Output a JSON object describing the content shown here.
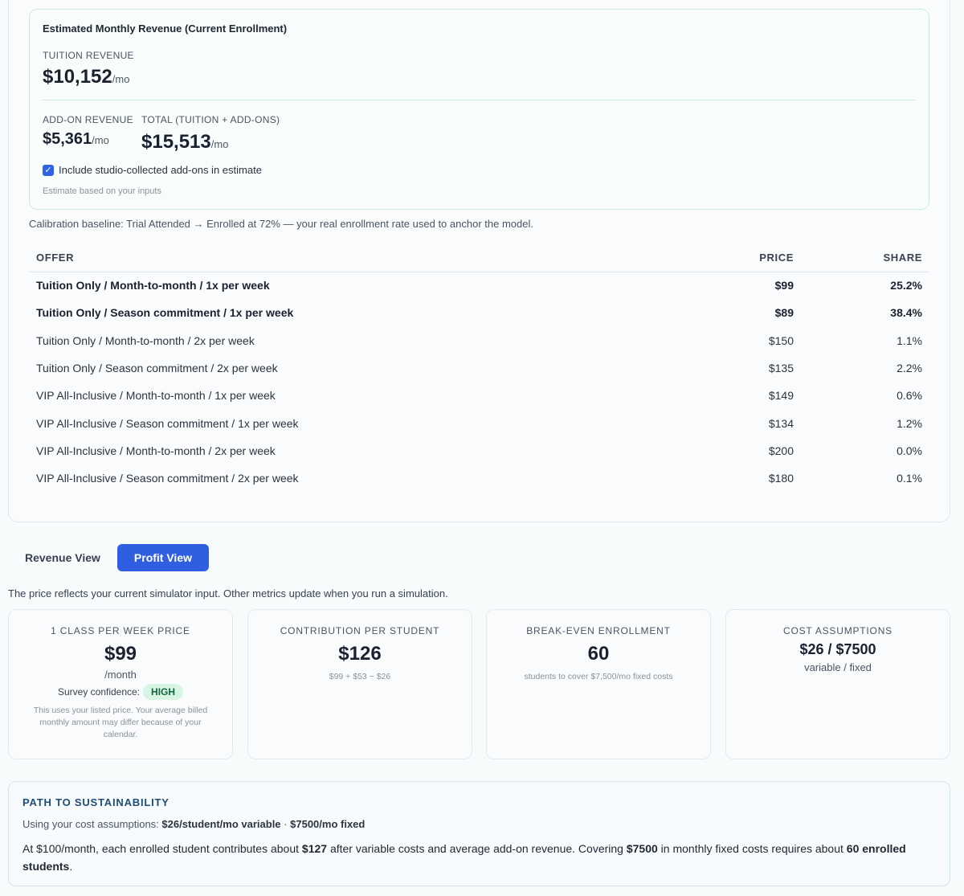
{
  "revenue": {
    "title": "Estimated Monthly Revenue (Current Enrollment)",
    "tuition_label": "TUITION REVENUE",
    "tuition_value": "$10,152",
    "per_month": "/mo",
    "addon_label": "ADD-ON REVENUE",
    "addon_value": "$5,361",
    "total_label": "TOTAL (TUITION + ADD-ONS)",
    "total_value": "$15,513",
    "checkbox_label": "Include studio-collected add-ons in estimate",
    "checkbox_checked": true,
    "estimate_note": "Estimate based on your inputs"
  },
  "calibration_text": "Calibration baseline: Trial Attended → Enrolled at 72% — your real enrollment rate used to anchor the model.",
  "offers": {
    "headers": [
      "OFFER",
      "PRICE",
      "SHARE"
    ],
    "rows": [
      {
        "offer": "Tuition Only / Month-to-month / 1x per week",
        "price": "$99",
        "share": "25.2%",
        "bold": true
      },
      {
        "offer": "Tuition Only / Season commitment / 1x per week",
        "price": "$89",
        "share": "38.4%",
        "bold": true
      },
      {
        "offer": "Tuition Only / Month-to-month / 2x per week",
        "price": "$150",
        "share": "1.1%",
        "bold": false
      },
      {
        "offer": "Tuition Only / Season commitment / 2x per week",
        "price": "$135",
        "share": "2.2%",
        "bold": false
      },
      {
        "offer": "VIP All-Inclusive / Month-to-month / 1x per week",
        "price": "$149",
        "share": "0.6%",
        "bold": false
      },
      {
        "offer": "VIP All-Inclusive / Season commitment / 1x per week",
        "price": "$134",
        "share": "1.2%",
        "bold": false
      },
      {
        "offer": "VIP All-Inclusive / Month-to-month / 2x per week",
        "price": "$200",
        "share": "0.0%",
        "bold": false
      },
      {
        "offer": "VIP All-Inclusive / Season commitment / 2x per week",
        "price": "$180",
        "share": "0.1%",
        "bold": false
      }
    ]
  },
  "tabs": {
    "revenue_label": "Revenue View",
    "profit_label": "Profit View",
    "active": "Profit View"
  },
  "view_note": "The price reflects your current simulator input. Other metrics update when you run a simulation.",
  "metrics": {
    "price": {
      "label": "1 CLASS PER WEEK PRICE",
      "value": "$99",
      "unit": "/month",
      "confidence_label": "Survey confidence:",
      "confidence_value": "HIGH",
      "note": "This uses your listed price. Your average billed monthly amount may differ because of your calendar."
    },
    "contribution": {
      "label": "CONTRIBUTION PER STUDENT",
      "value": "$126",
      "formula": "$99 + $53 − $26"
    },
    "breakeven": {
      "label": "BREAK-EVEN ENROLLMENT",
      "value": "60",
      "note": "students to cover $7,500/mo fixed costs"
    },
    "costs": {
      "label": "COST ASSUMPTIONS",
      "value": "$26 / $7500",
      "note": "variable / fixed"
    }
  },
  "path": {
    "title": "PATH TO SUSTAINABILITY",
    "using_prefix": "Using your cost assumptions:",
    "variable": "$26/student/mo variable",
    "separator": "·",
    "fixed": "$7500/mo fixed",
    "body_1": "At $100/month, each enrolled student contributes about",
    "contribution": "$127",
    "body_2": "after variable costs and average add-on revenue. Covering",
    "fixed_amount": "$7500",
    "body_3": "in monthly fixed costs requires about",
    "students_needed": "60 enrolled students",
    "body_end": "."
  },
  "colors": {
    "accent": "#2f5fe0",
    "badge_bg": "#d6f5e3",
    "badge_text": "#15663f",
    "path_title": "#1e4d78"
  }
}
